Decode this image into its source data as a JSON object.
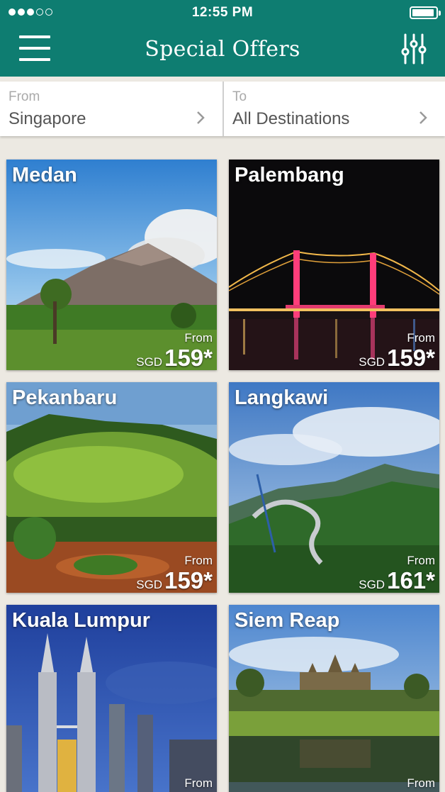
{
  "status_bar": {
    "time": "12:55 PM"
  },
  "header": {
    "title": "Special Offers"
  },
  "route": {
    "from_label": "From",
    "from_value": "Singapore",
    "to_label": "To",
    "to_value": "All Destinations"
  },
  "offers": [
    {
      "city": "Medan",
      "from_label": "From",
      "currency": "SGD",
      "price": "159*"
    },
    {
      "city": "Palembang",
      "from_label": "From",
      "currency": "SGD",
      "price": "159*"
    },
    {
      "city": "Pekanbaru",
      "from_label": "From",
      "currency": "SGD",
      "price": "159*"
    },
    {
      "city": "Langkawi",
      "from_label": "From",
      "currency": "SGD",
      "price": "161*"
    },
    {
      "city": "Kuala Lumpur",
      "from_label": "From"
    },
    {
      "city": "Siem Reap",
      "from_label": "From"
    }
  ],
  "colors": {
    "header": "#0e7d71",
    "background": "#ece9e2"
  }
}
